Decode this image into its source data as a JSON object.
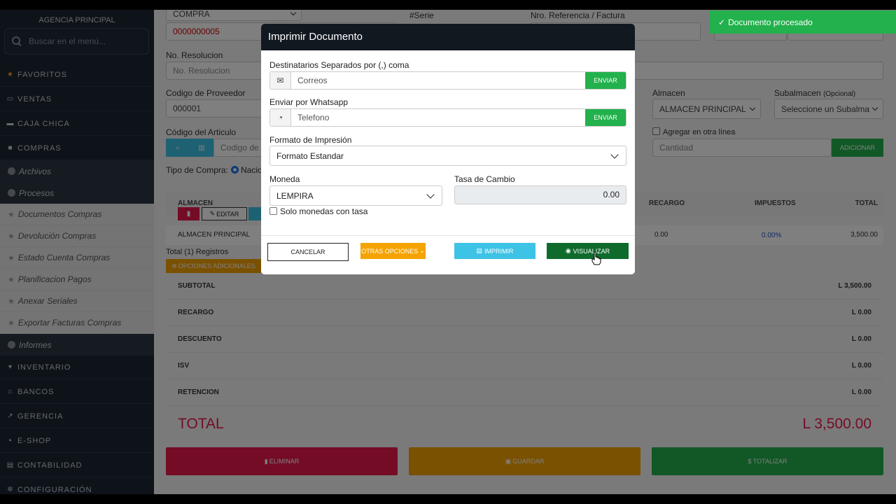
{
  "sidebar": {
    "agency": "AGENCIA PRINCIPAL",
    "search_placeholder": "Buscar en el menú...",
    "items": [
      {
        "label": "FAVORITOS",
        "icon": "star-icon"
      },
      {
        "label": "VENTAS",
        "icon": "credit-card-icon"
      },
      {
        "label": "CAJA CHICA",
        "icon": "cash-icon"
      },
      {
        "label": "COMPRAS",
        "icon": "truck-icon"
      }
    ],
    "compras_sub": [
      "Archivos",
      "Procesos"
    ],
    "procesos_sub": [
      "Documentos Compras",
      "Devolución Compras",
      "Estado Cuenta Compras",
      "Planificacion Pagos",
      "Anexar Seriales",
      "Exportar Facturas Compras"
    ],
    "informes": "Informes",
    "bottom_items": [
      {
        "label": "INVENTARIO",
        "icon": "cart-icon"
      },
      {
        "label": "BANCOS",
        "icon": "bank-icon"
      },
      {
        "label": "GERENCIA",
        "icon": "chart-icon"
      },
      {
        "label": "E-SHOP",
        "icon": "lock-icon"
      },
      {
        "label": "CONTABILIDAD",
        "icon": "calculator-icon"
      },
      {
        "label": "CONFIGURACIÓN",
        "icon": "gear-icon"
      }
    ]
  },
  "form": {
    "doc_type": "COMPRA",
    "doc_number": "0000000005",
    "serie_label": "#Serie",
    "ref_label": "Nro. Referencia / Factura",
    "resolucion_label": "No. Resolucion",
    "resolucion_placeholder": "No. Resolucion",
    "proveedor_label": "Codigo de Proveedor",
    "proveedor_value": "000001",
    "almacen_label": "Almacen",
    "almacen_value": "ALMACEN PRINCIPAL",
    "subalmacen_label": "Subalmacen",
    "subalmacen_optional": "(Opcional)",
    "subalmacen_value": "Seleccione un Subalma",
    "articulo_label": "Código del Articulo",
    "articulo_placeholder": "Codigo de A",
    "otra_linea_label": "Agregar en otra línea",
    "cantidad_placeholder": "Cantidad",
    "adicionar_label": "ADICIONAR",
    "tipo_compra_label": "Tipo de Compra:",
    "tipo_compra_value": "Nacio"
  },
  "table": {
    "headers": {
      "almacen": "ALMACEN",
      "recargo": "RECARGO",
      "impuestos": "IMPUESTOS",
      "total": "TOTAL"
    },
    "edit_label": "EDITAR",
    "row": {
      "almacen": "ALMACEN PRINCIPAL",
      "recargo": "0.00",
      "impuestos": "0.00%",
      "total": "3,500.00"
    },
    "total_registros": "Total (1) Registros",
    "opciones_adicionales": "OPCIONES ADICIONALES"
  },
  "totals": [
    {
      "label": "SUBTOTAL",
      "value": "L 3,500.00"
    },
    {
      "label": "RECARGO",
      "value": "L 0.00"
    },
    {
      "label": "DESCUENTO",
      "value": "L 0.00"
    },
    {
      "label": "ISV",
      "value": "L 0.00"
    },
    {
      "label": "RETENCION",
      "value": "L 0.00"
    }
  ],
  "grand_total": {
    "label": "TOTAL",
    "value": "L 3,500.00"
  },
  "actions": {
    "eliminar": "ELIMINAR",
    "guardar": "GUARDAR",
    "totalizar": "$ TOTALIZAR"
  },
  "toast": {
    "message": "Documento procesado"
  },
  "modal": {
    "title": "Imprimir Documento",
    "email_label": "Destinatarios Separados por (,) coma",
    "email_placeholder": "Correos",
    "whatsapp_label": "Enviar por Whatsapp",
    "whatsapp_placeholder": "Telefono",
    "send_label": "ENVIAR",
    "format_label": "Formato de Impresión",
    "format_value": "Formato Estandar",
    "currency_label": "Moneda",
    "currency_value": "LEMPIRA",
    "rate_label": "Tasa de Cambio",
    "rate_value": "0.00",
    "only_rate_label": "Solo monedas con tasa",
    "cancel": "CANCELAR",
    "other_options": "OTRAS OPCIONES",
    "print": "IMPRIMIR",
    "preview": "VISUALIZAR"
  },
  "colors": {
    "sidebar": "#1d2733",
    "red": "#e8194d",
    "orange": "#f5a300",
    "green": "#22b14c",
    "cyan": "#3cc3e6",
    "dark_green": "#0f6b2c"
  }
}
